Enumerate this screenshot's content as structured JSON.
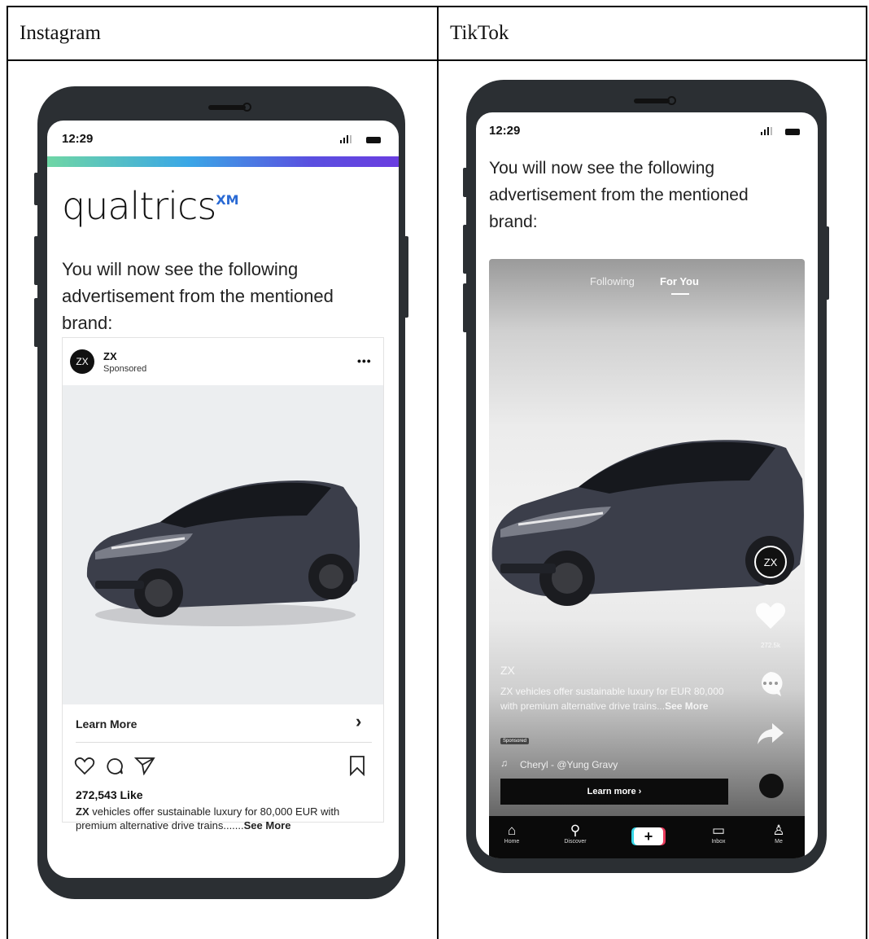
{
  "table": {
    "headers": [
      "Instagram",
      "TikTok"
    ]
  },
  "instagram": {
    "status": {
      "time": "12:29"
    },
    "brand_logo": "qualtrics",
    "brand_logo_sup": "XM",
    "intro_text": "You will now see the following advertisement from the mentioned brand:",
    "post": {
      "avatar_text": "ZX",
      "username": "ZX",
      "sponsored_label": "Sponsored",
      "more_label": "•••",
      "cta_label": "Learn More",
      "cta_chevron": "›",
      "likes": "272,543 Like",
      "caption_user": "ZX",
      "caption_text": " vehicles offer sustainable luxury for 80,000 EUR with premium alternative drive trains.......",
      "caption_more": "See More"
    },
    "icons": [
      "heart-icon",
      "comment-icon",
      "share-icon",
      "bookmark-icon"
    ]
  },
  "tiktok": {
    "status": {
      "time": "12:29"
    },
    "intro_text": "You will now see the following advertisement from the mentioned brand:",
    "tabs": {
      "following": "Following",
      "for_you": "For You"
    },
    "avatar_text": "ZX",
    "like_count": "272.5k",
    "account": "ZX",
    "caption_text": "ZX vehicles offer sustainable luxury for EUR 80,000 with premium alternative drive trains...",
    "caption_more": "See More",
    "sponsored_badge": "Sponsored",
    "music": "Cheryl - @Yung Gravy",
    "cta_label": "Learn more ›",
    "nav": [
      {
        "label": "Home",
        "icon": "home-icon"
      },
      {
        "label": "Discover",
        "icon": "search-icon"
      },
      {
        "label": "",
        "icon": "plus-icon"
      },
      {
        "label": "Inbox",
        "icon": "inbox-icon"
      },
      {
        "label": "Me",
        "icon": "profile-icon"
      }
    ]
  },
  "colors": {
    "phone_frame": "#2b2f33",
    "qualtrics_xm_blue": "#2a6ad4",
    "gradient": [
      "#6fd6a5",
      "#3aa7e6",
      "#5a4fe0",
      "#6a3de0"
    ],
    "tiktok_cyan": "#36d6e7",
    "tiktok_red": "#ea3b5c"
  }
}
